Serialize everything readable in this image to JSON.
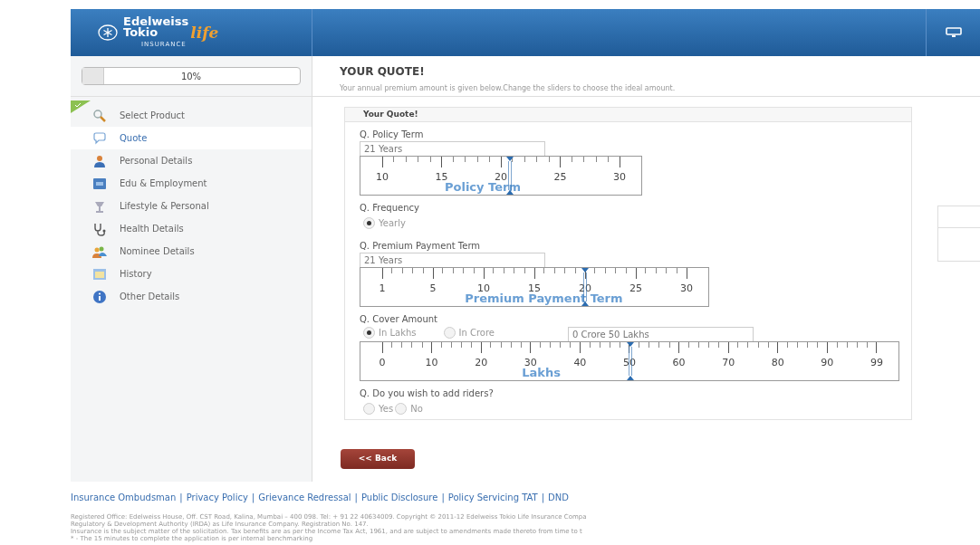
{
  "header": {
    "logo": {
      "line1": "Edelweiss",
      "line2": "Tokio",
      "script": "life",
      "tagline": "INSURANCE"
    }
  },
  "progress": {
    "label": "10%",
    "level": 0.1
  },
  "sidebar": {
    "items": [
      {
        "label": "Select Product",
        "selected": false,
        "completed": true
      },
      {
        "label": "Quote",
        "selected": true,
        "completed": false
      },
      {
        "label": "Personal Details",
        "selected": false,
        "completed": false
      },
      {
        "label": "Edu & Employment",
        "selected": false,
        "completed": false
      },
      {
        "label": "Lifestyle & Personal",
        "selected": false,
        "completed": false
      },
      {
        "label": "Health Details",
        "selected": false,
        "completed": false
      },
      {
        "label": "Nominee Details",
        "selected": false,
        "completed": false
      },
      {
        "label": "History",
        "selected": false,
        "completed": false
      },
      {
        "label": "Other Details",
        "selected": false,
        "completed": false
      }
    ]
  },
  "page": {
    "title": "YOUR QUOTE!",
    "subtitle": "Your annual premium amount is given below.Change the sliders to choose the ideal amount."
  },
  "card": {
    "title": "Your Quote!",
    "questions": [
      {
        "kind": "slider",
        "label": "Q. Policy Term",
        "value": "21 Years",
        "watermark": "Policy Term",
        "ticks": [
          "10",
          "15",
          "20",
          "25",
          "30"
        ]
      },
      {
        "kind": "radio",
        "label": "Q. Frequency",
        "options": [
          {
            "label": "Yearly",
            "selected": true
          }
        ]
      },
      {
        "kind": "slider",
        "label": "Q. Premium Payment Term",
        "value": "21 Years",
        "watermark": "Premium Payment Term",
        "ticks": [
          "1",
          "5",
          "10",
          "15",
          "20",
          "25",
          "30"
        ]
      },
      {
        "kind": "slider",
        "label": "Q. Cover Amount",
        "options": [
          {
            "label": "In Lakhs",
            "selected": true
          },
          {
            "label": "In Crore",
            "selected": false
          }
        ],
        "value": "0 Crore 50 Lakhs",
        "watermark": "Lakhs",
        "ticks": [
          "0",
          "10",
          "20",
          "30",
          "40",
          "50",
          "60",
          "70",
          "80",
          "90",
          "99"
        ]
      },
      {
        "kind": "radio",
        "label": "Q. Do you wish to add riders?",
        "options": [
          {
            "label": "Yes",
            "selected": false
          },
          {
            "label": "No",
            "selected": false
          }
        ]
      }
    ]
  },
  "back_button": "<< Back",
  "footer": {
    "separator": "|",
    "links": [
      "Insurance Ombudsman",
      "Privacy Policy",
      "Grievance Redressal",
      "Public Disclosure",
      "Policy Servicing TAT",
      "DND"
    ],
    "legal": [
      "Registered Office: Edelweiss House, Off. CST Road, Kalina, Mumbai – 400 098. Tel: + 91 22 40634009. Copyright © 2011-12 Edelweiss Tokio Life Insurance Compa",
      "Regulatory & Development Authority (IRDA) as Life Insurance Company. Registration No. 147.",
      "Insurance is the subject matter of the solicitation. Tax benefits are as per the Income Tax Act, 1961, and are subject to amendments made thereto from time to t",
      "* - The 15 minutes to complete the application is per internal benchmarking"
    ]
  }
}
